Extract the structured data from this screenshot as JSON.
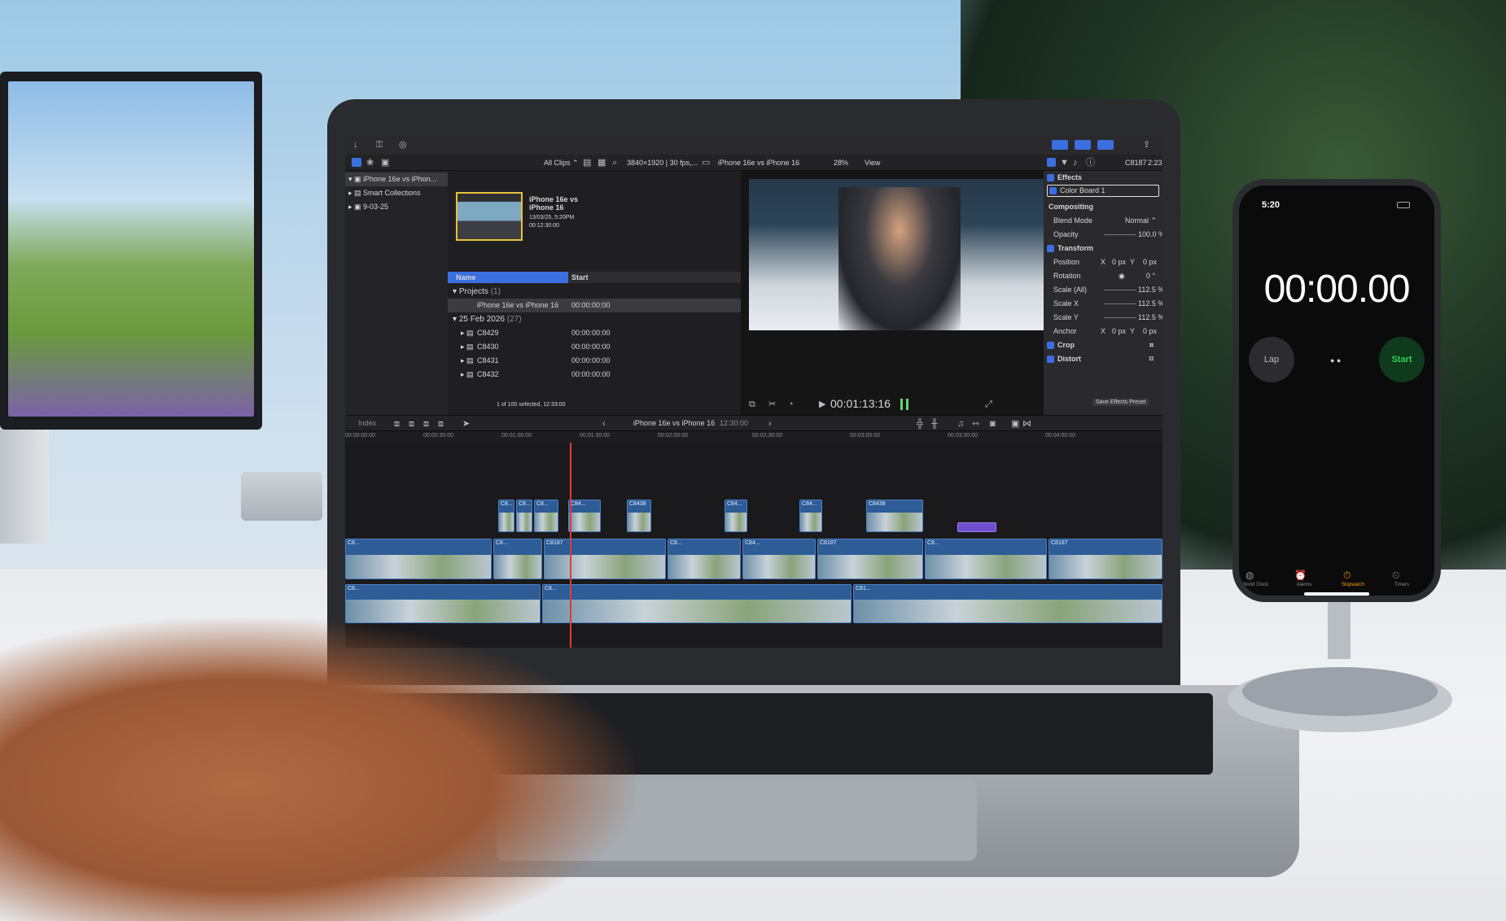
{
  "app": {
    "toolbar": {
      "all_clips": "All Clips ⌃",
      "format": "3840×1920 | 30 fps,...",
      "project": "iPhone 16e vs iPhone 16",
      "zoom": "28%",
      "view": "View",
      "clip_name": "C8187",
      "timecode_display": "2:23"
    },
    "library": {
      "items": [
        {
          "label": "iPhone 16e vs iPhon..."
        },
        {
          "label": "Smart Collections"
        },
        {
          "label": "9-03-25"
        }
      ]
    },
    "browser": {
      "thumb_title": "iPhone 16e vs iPhone 16",
      "thumb_date": "13/03/25, 5:20PM",
      "thumb_duration": "00:12:30:00",
      "col_name": "Name",
      "col_start": "Start",
      "groups": [
        {
          "label": "Projects",
          "count": "(1)"
        },
        {
          "label": "25 Feb 2026",
          "count": "(27)"
        }
      ],
      "project_row": {
        "name": "iPhone 16e vs iPhone 16",
        "start": "00:00:00:00"
      },
      "clips": [
        {
          "name": "C8429",
          "start": "00:00:00:00"
        },
        {
          "name": "C8430",
          "start": "00:00:00:00"
        },
        {
          "name": "C8431",
          "start": "00:00:00:00"
        },
        {
          "name": "C8432",
          "start": "00:00:00:00"
        }
      ],
      "footer": "1 of 100 selected, 12:33:00"
    },
    "viewer": {
      "timecode": "00:01:13:16"
    },
    "inspector": {
      "effects": "Effects",
      "color_board": "Color Board 1",
      "compositing": "Compositing",
      "blend_mode_label": "Blend Mode",
      "blend_mode_value": "Normal ⌃",
      "opacity_label": "Opacity",
      "opacity_value": "100.0 %",
      "transform": "Transform",
      "position_label": "Position",
      "position_x": "0 px",
      "position_y": "0 px",
      "axis_x": "X",
      "axis_y": "Y",
      "rotation_label": "Rotation",
      "rotation_value": "0 °",
      "scale_all_label": "Scale (All)",
      "scale_all_value": "112.5 %",
      "scale_x_label": "Scale X",
      "scale_x_value": "112.5 %",
      "scale_y_label": "Scale Y",
      "scale_y_value": "112.5 %",
      "anchor_label": "Anchor",
      "anchor_x": "0 px",
      "anchor_y": "0 px",
      "crop": "Crop",
      "distort": "Distort",
      "save_preset": "Save Effects Preset"
    },
    "timeline_bar": {
      "index": "Index",
      "project": "iPhone 16e vs iPhone 16",
      "duration": "12:30:00"
    },
    "ruler": [
      "00:00:00:00",
      "00:00:30:00",
      "00:01:00:00",
      "00:01:30:00",
      "00:02:00:00",
      "00:02:30:00",
      "00:03:00:00",
      "00:03:30:00",
      "00:04:00:00"
    ],
    "connected_clips": [
      "C8...",
      "C8...",
      "C8...",
      "C84...",
      "C8438",
      "C84...",
      "C84...",
      "C8438"
    ],
    "primary_clips": [
      "C8...",
      "C8...",
      "C8187",
      "C8...",
      "C84...",
      "C8187",
      "C8...",
      "C8187",
      "C8...",
      "C8...",
      "C81..."
    ]
  },
  "phone": {
    "status_time": "5:20",
    "stopwatch": "00:00.00",
    "lap": "Lap",
    "start": "Start",
    "tabs": [
      "World Clock",
      "Alarms",
      "Stopwatch",
      "Timers"
    ]
  },
  "colors": {
    "accent_blue": "#3b6fe0",
    "clip_blue": "#2d5c96",
    "playhead_red": "#e33b33",
    "start_green": "#30d158"
  }
}
